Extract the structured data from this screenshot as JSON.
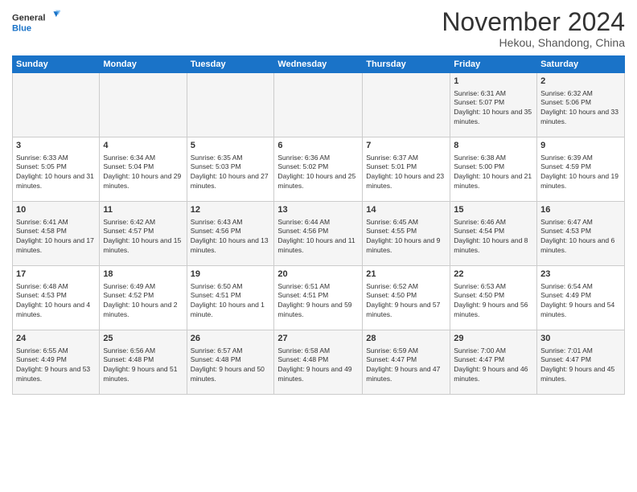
{
  "logo": {
    "line1": "General",
    "line2": "Blue"
  },
  "title": "November 2024",
  "subtitle": "Hekou, Shandong, China",
  "days_of_week": [
    "Sunday",
    "Monday",
    "Tuesday",
    "Wednesday",
    "Thursday",
    "Friday",
    "Saturday"
  ],
  "weeks": [
    {
      "days": [
        {
          "num": "",
          "content": ""
        },
        {
          "num": "",
          "content": ""
        },
        {
          "num": "",
          "content": ""
        },
        {
          "num": "",
          "content": ""
        },
        {
          "num": "",
          "content": ""
        },
        {
          "num": "1",
          "content": "Sunrise: 6:31 AM\nSunset: 5:07 PM\nDaylight: 10 hours and 35 minutes."
        },
        {
          "num": "2",
          "content": "Sunrise: 6:32 AM\nSunset: 5:06 PM\nDaylight: 10 hours and 33 minutes."
        }
      ]
    },
    {
      "days": [
        {
          "num": "3",
          "content": "Sunrise: 6:33 AM\nSunset: 5:05 PM\nDaylight: 10 hours and 31 minutes."
        },
        {
          "num": "4",
          "content": "Sunrise: 6:34 AM\nSunset: 5:04 PM\nDaylight: 10 hours and 29 minutes."
        },
        {
          "num": "5",
          "content": "Sunrise: 6:35 AM\nSunset: 5:03 PM\nDaylight: 10 hours and 27 minutes."
        },
        {
          "num": "6",
          "content": "Sunrise: 6:36 AM\nSunset: 5:02 PM\nDaylight: 10 hours and 25 minutes."
        },
        {
          "num": "7",
          "content": "Sunrise: 6:37 AM\nSunset: 5:01 PM\nDaylight: 10 hours and 23 minutes."
        },
        {
          "num": "8",
          "content": "Sunrise: 6:38 AM\nSunset: 5:00 PM\nDaylight: 10 hours and 21 minutes."
        },
        {
          "num": "9",
          "content": "Sunrise: 6:39 AM\nSunset: 4:59 PM\nDaylight: 10 hours and 19 minutes."
        }
      ]
    },
    {
      "days": [
        {
          "num": "10",
          "content": "Sunrise: 6:41 AM\nSunset: 4:58 PM\nDaylight: 10 hours and 17 minutes."
        },
        {
          "num": "11",
          "content": "Sunrise: 6:42 AM\nSunset: 4:57 PM\nDaylight: 10 hours and 15 minutes."
        },
        {
          "num": "12",
          "content": "Sunrise: 6:43 AM\nSunset: 4:56 PM\nDaylight: 10 hours and 13 minutes."
        },
        {
          "num": "13",
          "content": "Sunrise: 6:44 AM\nSunset: 4:56 PM\nDaylight: 10 hours and 11 minutes."
        },
        {
          "num": "14",
          "content": "Sunrise: 6:45 AM\nSunset: 4:55 PM\nDaylight: 10 hours and 9 minutes."
        },
        {
          "num": "15",
          "content": "Sunrise: 6:46 AM\nSunset: 4:54 PM\nDaylight: 10 hours and 8 minutes."
        },
        {
          "num": "16",
          "content": "Sunrise: 6:47 AM\nSunset: 4:53 PM\nDaylight: 10 hours and 6 minutes."
        }
      ]
    },
    {
      "days": [
        {
          "num": "17",
          "content": "Sunrise: 6:48 AM\nSunset: 4:53 PM\nDaylight: 10 hours and 4 minutes."
        },
        {
          "num": "18",
          "content": "Sunrise: 6:49 AM\nSunset: 4:52 PM\nDaylight: 10 hours and 2 minutes."
        },
        {
          "num": "19",
          "content": "Sunrise: 6:50 AM\nSunset: 4:51 PM\nDaylight: 10 hours and 1 minute."
        },
        {
          "num": "20",
          "content": "Sunrise: 6:51 AM\nSunset: 4:51 PM\nDaylight: 9 hours and 59 minutes."
        },
        {
          "num": "21",
          "content": "Sunrise: 6:52 AM\nSunset: 4:50 PM\nDaylight: 9 hours and 57 minutes."
        },
        {
          "num": "22",
          "content": "Sunrise: 6:53 AM\nSunset: 4:50 PM\nDaylight: 9 hours and 56 minutes."
        },
        {
          "num": "23",
          "content": "Sunrise: 6:54 AM\nSunset: 4:49 PM\nDaylight: 9 hours and 54 minutes."
        }
      ]
    },
    {
      "days": [
        {
          "num": "24",
          "content": "Sunrise: 6:55 AM\nSunset: 4:49 PM\nDaylight: 9 hours and 53 minutes."
        },
        {
          "num": "25",
          "content": "Sunrise: 6:56 AM\nSunset: 4:48 PM\nDaylight: 9 hours and 51 minutes."
        },
        {
          "num": "26",
          "content": "Sunrise: 6:57 AM\nSunset: 4:48 PM\nDaylight: 9 hours and 50 minutes."
        },
        {
          "num": "27",
          "content": "Sunrise: 6:58 AM\nSunset: 4:48 PM\nDaylight: 9 hours and 49 minutes."
        },
        {
          "num": "28",
          "content": "Sunrise: 6:59 AM\nSunset: 4:47 PM\nDaylight: 9 hours and 47 minutes."
        },
        {
          "num": "29",
          "content": "Sunrise: 7:00 AM\nSunset: 4:47 PM\nDaylight: 9 hours and 46 minutes."
        },
        {
          "num": "30",
          "content": "Sunrise: 7:01 AM\nSunset: 4:47 PM\nDaylight: 9 hours and 45 minutes."
        }
      ]
    }
  ]
}
